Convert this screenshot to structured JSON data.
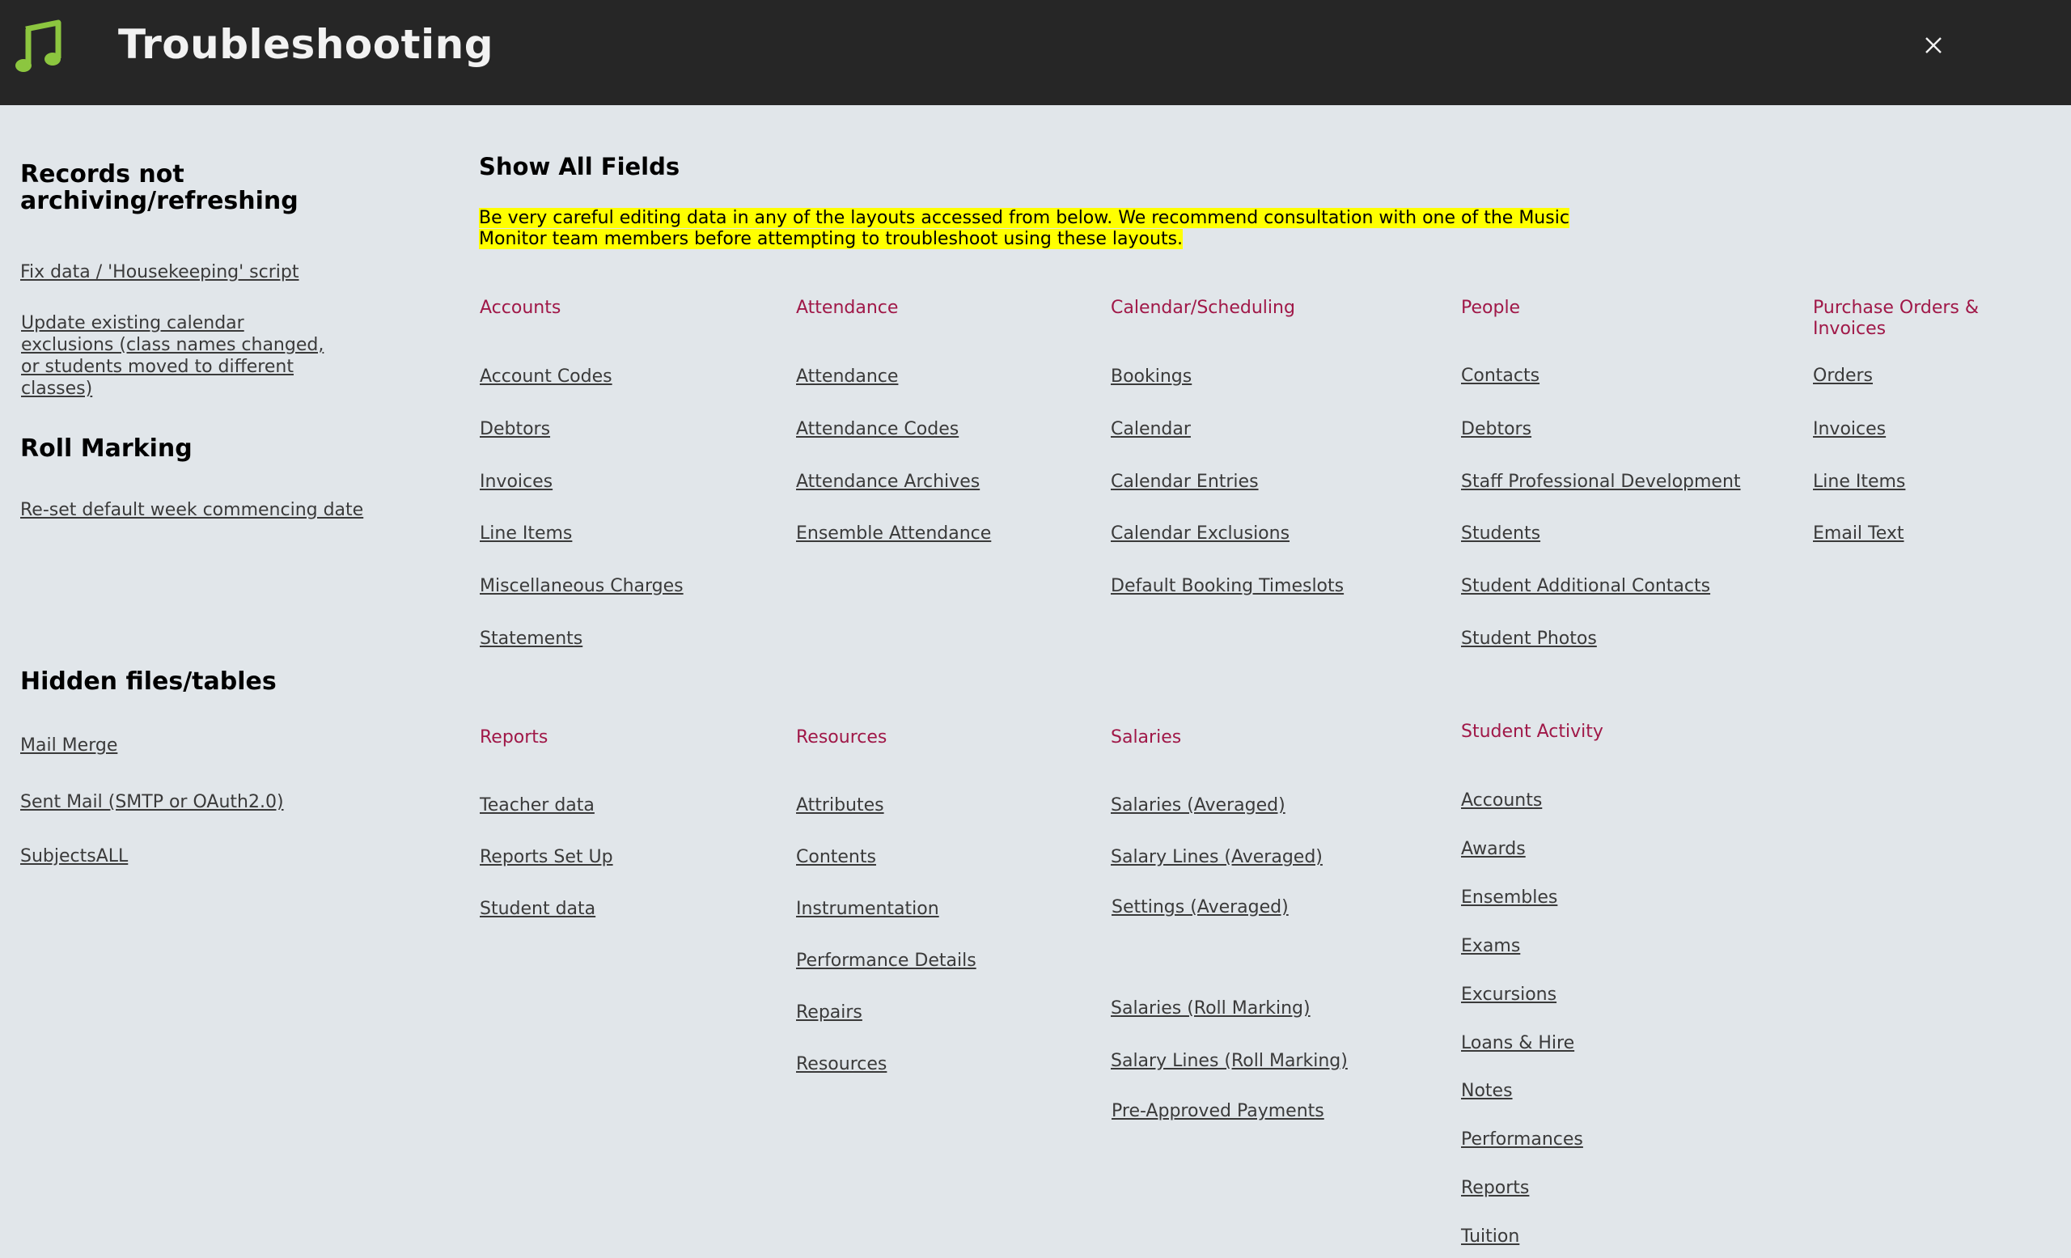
{
  "header": {
    "title": "Troubleshooting",
    "app_icon": "music-note-icon",
    "close_icon": "close-icon",
    "accent_color": "#8cc63f"
  },
  "left": {
    "records_heading": "Records not archiving/refreshing",
    "records_links": [
      "Fix data / 'Housekeeping' script",
      "Update existing calendar exclusions (class names changed, or students moved to different classes)"
    ],
    "roll_heading": "Roll Marking",
    "roll_links": [
      "Re-set default week commencing date"
    ],
    "hidden_heading": "Hidden files/tables",
    "hidden_links": [
      "Mail Merge",
      "Sent Mail (SMTP or OAuth2.0)",
      "SubjectsALL"
    ]
  },
  "main": {
    "heading": "Show All Fields",
    "warning": "Be very careful editing data in any of the layouts accessed from below. We recommend consultation with one of the Music Monitor team members before attempting to troubleshoot using these layouts.",
    "categories": {
      "accounts": {
        "title": "Accounts",
        "links": [
          "Account Codes",
          "Debtors",
          "Invoices",
          "Line Items",
          "Miscellaneous Charges",
          "Statements"
        ]
      },
      "attendance": {
        "title": "Attendance",
        "links": [
          "Attendance",
          "Attendance Codes",
          "Attendance Archives",
          "Ensemble Attendance"
        ]
      },
      "calendar": {
        "title": "Calendar/Scheduling",
        "links": [
          "Bookings",
          "Calendar",
          "Calendar Entries",
          "Calendar Exclusions",
          "Default Booking Timeslots"
        ]
      },
      "people": {
        "title": "People",
        "links": [
          "Contacts",
          "Debtors",
          "Staff Professional Development",
          "Students",
          "Student Additional Contacts",
          "Student Photos"
        ]
      },
      "purchase": {
        "title": "Purchase Orders & Invoices",
        "links": [
          "Orders",
          "Invoices",
          "Line Items",
          "Email Text"
        ]
      },
      "reports": {
        "title": "Reports",
        "links": [
          "Teacher data",
          "Reports Set Up",
          "Student data"
        ]
      },
      "resources": {
        "title": "Resources",
        "links": [
          "Attributes",
          "Contents",
          "Instrumentation",
          "Performance Details",
          "Repairs",
          "Resources"
        ]
      },
      "salaries": {
        "title": "Salaries",
        "links": [
          "Salaries (Averaged)",
          "Salary Lines (Averaged)",
          "Settings (Averaged)",
          "Salaries (Roll Marking)",
          "Salary Lines (Roll Marking)",
          "Pre-Approved Payments"
        ]
      },
      "activity": {
        "title": "Student Activity",
        "links": [
          "Accounts",
          "Awards",
          "Ensembles",
          "Exams",
          "Excursions",
          "Loans & Hire",
          "Notes",
          "Performances",
          "Reports",
          "Tuition"
        ]
      }
    }
  }
}
